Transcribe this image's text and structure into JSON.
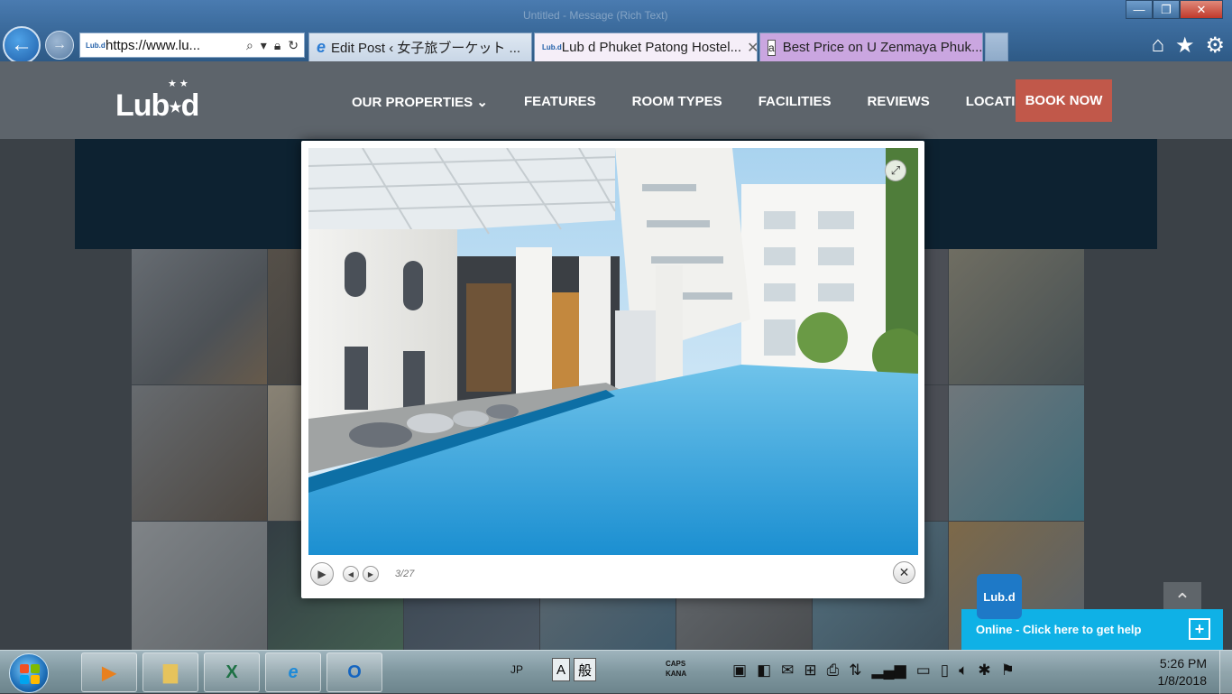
{
  "browser": {
    "window_title": "Untitled - Message (Rich Text)",
    "window_buttons": {
      "minimize": "—",
      "restore": "❐",
      "close": "✕"
    },
    "address_url": "https://www.lu...",
    "tabs": [
      {
        "label": "Edit Post ‹ 女子旅ブーケット ...",
        "icon": "ie-icon",
        "active": false
      },
      {
        "label": "Lub d Phuket Patong Hostel...",
        "icon": "lubd-favicon",
        "active": true
      },
      {
        "label": "Best Price on U Zenmaya Phuk...",
        "icon": "amazon-icon",
        "active": false
      }
    ],
    "toolbar_icons": [
      "home-icon",
      "favorites-star-icon",
      "settings-gear-icon"
    ]
  },
  "site": {
    "logo_text": "Lub",
    "logo_suffix": "d",
    "menu": [
      {
        "label": "OUR PROPERTIES ⌄"
      },
      {
        "label": "FEATURES"
      },
      {
        "label": "ROOM TYPES"
      },
      {
        "label": "FACILITIES"
      },
      {
        "label": "REVIEWS"
      },
      {
        "label": "LOCATION"
      }
    ],
    "book_now": "BOOK NOW"
  },
  "lightbox": {
    "counter": "3/27",
    "image_subject": "Hostel atrium with swimming pool and white multi-storey building"
  },
  "chat": {
    "logo": "Lub.d",
    "label": "Online - Click here to get help",
    "plus": "+"
  },
  "taskbar": {
    "language": "JP",
    "ime": [
      "A",
      "般"
    ],
    "caps_line1": "CAPS",
    "caps_line2": "KANA",
    "clock_time": "5:26 PM",
    "clock_date": "1/8/2018",
    "apps": [
      "media-player-icon",
      "file-explorer-icon",
      "excel-icon",
      "internet-explorer-icon",
      "outlook-icon"
    ]
  },
  "colors": {
    "header_bg": "#5d646b",
    "book_now_bg": "#c1584a",
    "chat_bar": "#0fb1e6",
    "hero_band": "#0d2231"
  }
}
